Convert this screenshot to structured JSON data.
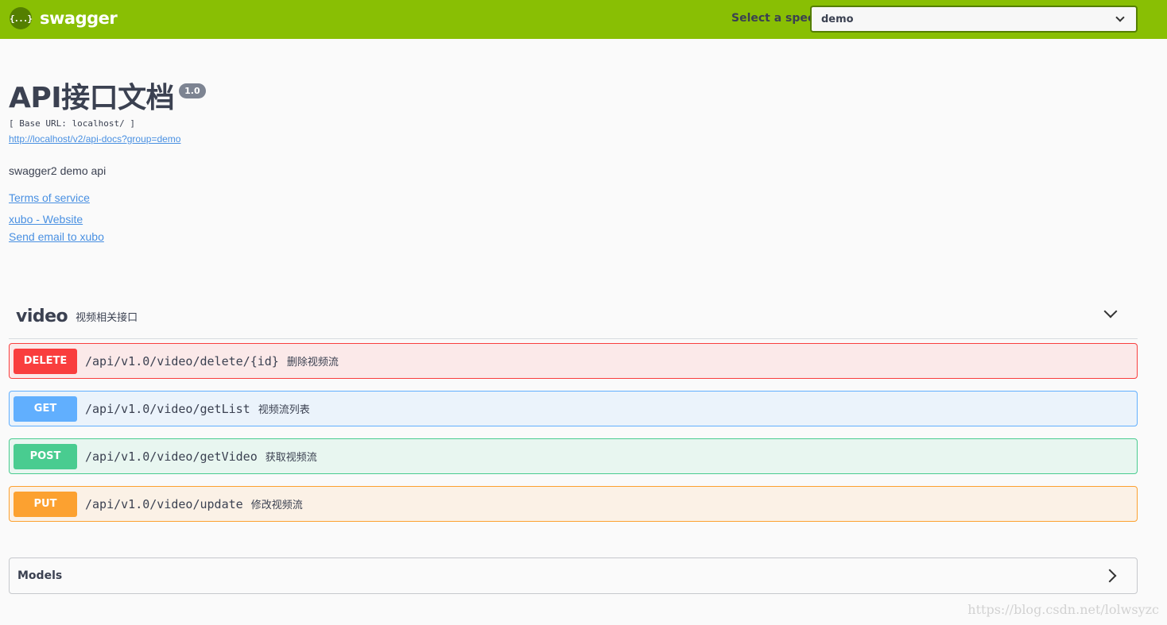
{
  "topbar": {
    "logo_glyph": "{...}",
    "logo_text": "swagger",
    "spec_label": "Select a spec",
    "spec_value": "demo"
  },
  "info": {
    "title": "API接口文档",
    "version": "1.0",
    "base_url": "[ Base URL: localhost/ ]",
    "docs_url": "http://localhost/v2/api-docs?group=demo",
    "description": "swagger2 demo api",
    "terms": "Terms of service",
    "website": "xubo - Website",
    "email": "Send email to xubo"
  },
  "tag": {
    "name": "video",
    "description": "视频相关接口"
  },
  "operations": [
    {
      "method": "DELETE",
      "path": "/api/v1.0/video/delete/{id}",
      "summary": "删除视频流",
      "color": "#f93e3e"
    },
    {
      "method": "GET",
      "path": "/api/v1.0/video/getList",
      "summary": "视频流列表",
      "color": "#61affe"
    },
    {
      "method": "POST",
      "path": "/api/v1.0/video/getVideo",
      "summary": "获取视频流",
      "color": "#49cc90"
    },
    {
      "method": "PUT",
      "path": "/api/v1.0/video/update",
      "summary": "修改视频流",
      "color": "#fca130"
    }
  ],
  "models": {
    "title": "Models"
  },
  "watermark": "https://blog.csdn.net/lolwsyzc"
}
